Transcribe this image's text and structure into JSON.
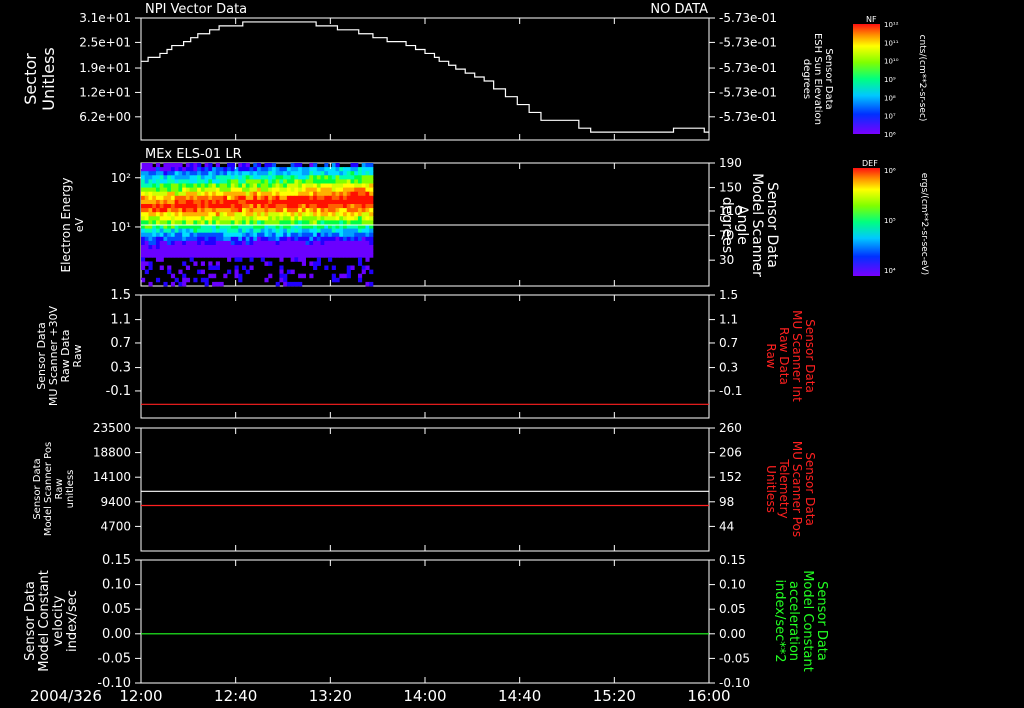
{
  "theme": {
    "background": "#000000",
    "foreground": "#ffffff",
    "red": "#ff2020",
    "green": "#22ff22"
  },
  "chart_data": [
    {
      "type": "line",
      "title": "NPI Vector Data",
      "status": "NO DATA",
      "ylabel_left": [
        "Sector",
        "Unitless"
      ],
      "ylabel_right": [
        "Sensor Data",
        "ESH Sun Elevation",
        "degrees"
      ],
      "yticks_left": [
        "3.1e+01",
        "2.5e+01",
        "1.9e+01",
        "1.2e+01",
        "6.2e+00"
      ],
      "yticks_right": [
        "-5.73e-01",
        "-5.73e-01",
        "-5.73e-01",
        "-5.73e-01",
        "-5.73e-01"
      ],
      "ylim": [
        0,
        31
      ],
      "series": [
        {
          "color": "#ffffff",
          "x": [
            "12:00",
            "12:03",
            "12:08",
            "12:11",
            "12:13",
            "12:18",
            "12:21",
            "12:24",
            "12:29",
            "12:33",
            "12:43",
            "12:49",
            "12:58",
            "13:14",
            "13:17",
            "13:23",
            "13:26",
            "13:29",
            "13:32",
            "13:35",
            "13:38",
            "13:41",
            "13:44",
            "13:47",
            "13:52",
            "13:56",
            "14:00",
            "14:04",
            "14:06",
            "14:10",
            "14:13",
            "14:17",
            "14:21",
            "14:25",
            "14:29",
            "14:34",
            "14:39",
            "14:44",
            "14:49",
            "15:05",
            "15:10",
            "15:25",
            "15:40",
            "15:45",
            "15:58",
            "16:00"
          ],
          "y": [
            20,
            21,
            22,
            23,
            24,
            25,
            26,
            27,
            28,
            29,
            30,
            30,
            30,
            29,
            29,
            28,
            28,
            28,
            27,
            27,
            26,
            26,
            25,
            25,
            24,
            23,
            22,
            21,
            20,
            19,
            18,
            17,
            16,
            15,
            13,
            11,
            9,
            7,
            5,
            3,
            2,
            2,
            2,
            3,
            2,
            2
          ]
        }
      ]
    },
    {
      "type": "heatmap",
      "title": "MEx ELS-01 LR",
      "ylabel_left": [
        "Electron Energy",
        "eV"
      ],
      "ylabel_right": [
        "Sensor Data",
        "Model Scanner",
        "Angle",
        "degrees"
      ],
      "yticks_left": [
        "10²",
        "10¹"
      ],
      "yticks_right": [
        "190",
        "150",
        "110",
        "70",
        "30"
      ],
      "yscale": "log",
      "data_span": [
        "12:00",
        "13:38"
      ],
      "colorbar": {
        "title": "DEF",
        "label": "ergs/(cm**2-sr-sec-eV)",
        "ticks": [
          "10⁶",
          "10⁵",
          "10⁴"
        ]
      }
    },
    {
      "type": "line",
      "ylabel_left": [
        "Sensor Data",
        "MU Scanner +30V",
        "Raw Data",
        "Raw"
      ],
      "ylabel_right": [
        "Sensor Data",
        "MU Scanner Int",
        "Raw Data",
        "Raw"
      ],
      "yticks_left": [
        "1.5",
        "1.1",
        "0.7",
        "0.3",
        "-0.1"
      ],
      "yticks_right": [
        "1.5",
        "1.1",
        "0.7",
        "0.3",
        "-0.1"
      ],
      "ylim": [
        -0.3,
        1.5
      ],
      "series": [
        {
          "color": "#ff2020",
          "x": [
            "12:00",
            "16:00"
          ],
          "y": [
            -0.1,
            -0.1
          ]
        }
      ]
    },
    {
      "type": "line",
      "ylabel_left": [
        "Sensor Data",
        "Model Scanner Pos",
        "Raw",
        "unitless"
      ],
      "ylabel_right": [
        "Sensor Data",
        "MU Scanner Pos",
        "Telemetry",
        "Unitless"
      ],
      "yticks_left": [
        "23500",
        "18800",
        "14100",
        "9400",
        "4700"
      ],
      "yticks_right": [
        "260",
        "206",
        "152",
        "98",
        "44"
      ],
      "ylim": [
        0,
        23500
      ],
      "series": [
        {
          "color": "#ffffff",
          "x": [
            "12:00",
            "16:00"
          ],
          "y": [
            11400,
            11400
          ]
        },
        {
          "color": "#ff2020",
          "x": [
            "12:00",
            "16:00"
          ],
          "y": [
            8700,
            8700
          ]
        }
      ]
    },
    {
      "type": "line",
      "ylabel_left": [
        "Sensor Data",
        "Model Constant",
        "velocity",
        "index/sec"
      ],
      "ylabel_right": [
        "Sensor Data",
        "Model Constant",
        "acceleration",
        "index/sec**2"
      ],
      "yticks_left": [
        "0.15",
        "0.10",
        "0.05",
        "0.00",
        "-0.05",
        "-0.10"
      ],
      "yticks_right": [
        "0.15",
        "0.10",
        "0.05",
        "0.00",
        "-0.05",
        "-0.10"
      ],
      "ylim": [
        -0.1,
        0.15
      ],
      "series": [
        {
          "color": "#22ff22",
          "x": [
            "12:00",
            "16:00"
          ],
          "y": [
            0,
            0
          ]
        }
      ]
    }
  ],
  "colorbar_nf": {
    "title": "NF",
    "label": "cnts/(cm**2-sr-sec)",
    "ticks": [
      "10¹²",
      "10¹¹",
      "10¹⁰",
      "10⁹",
      "10⁸",
      "10⁷",
      "10⁶"
    ]
  },
  "x_axis": {
    "date": "2004/326",
    "ticks": [
      "12:00",
      "12:40",
      "13:20",
      "14:00",
      "14:40",
      "15:20",
      "16:00"
    ]
  }
}
